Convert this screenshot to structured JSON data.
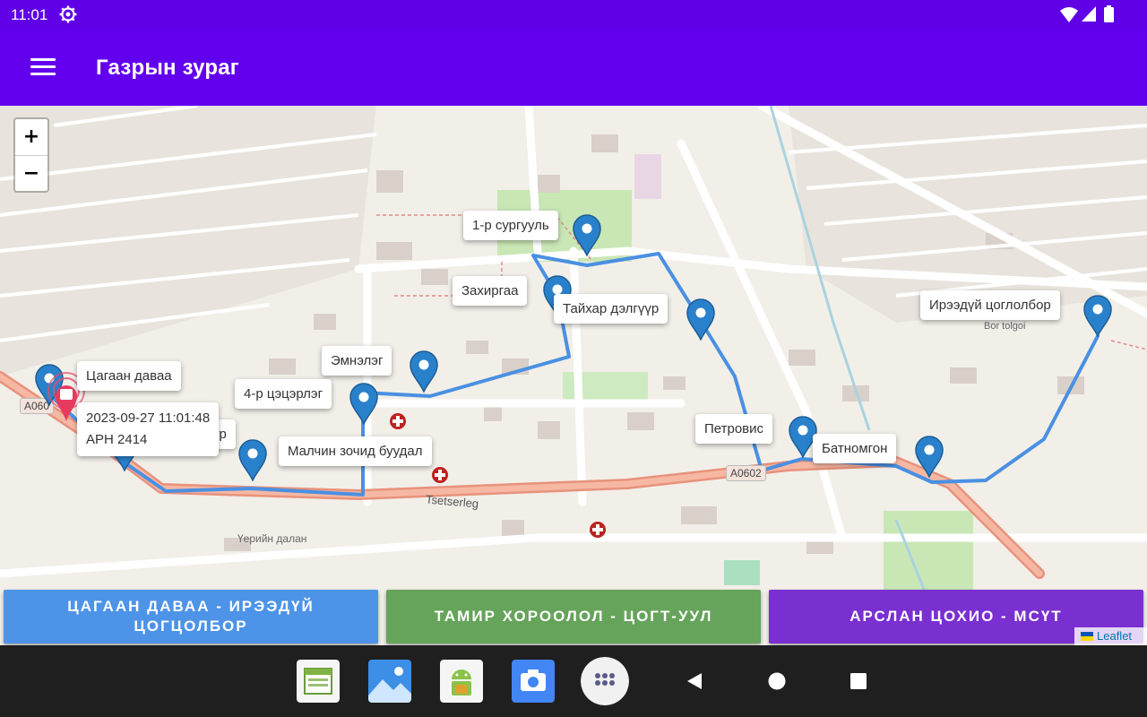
{
  "status_bar": {
    "time": "11:01"
  },
  "app_bar": {
    "title": "Газрын зураг"
  },
  "map": {
    "zoom_in": "+",
    "zoom_out": "−",
    "labels": {
      "school": "1-р сургууль",
      "zakhirgaa": "Захиргаа",
      "taikhar": "Тайхар дэлгүүр",
      "ireedui": "Ирээдүй цоглолбор",
      "emnelg": "Эмнэлэг",
      "ts4": "4-р цэцэрлэг",
      "tsagaan": "Цагаан даваа",
      "az": "Аз дэлгүүр",
      "malchin": "Малчин зочид буудал",
      "petrovis": "Петровис",
      "batnomgon": "Батномгон"
    },
    "vehicle": {
      "time": "2023-09-27 11:01:48",
      "plate": "АРН 2414"
    },
    "road_labels": {
      "tsetserleg": "Tsetserleg",
      "a0602": "A0602",
      "a060": "A060",
      "uerin": "Үерийн далан",
      "bor": "Bor tolgoi"
    },
    "attribution": "Leaflet"
  },
  "routes": [
    {
      "label": "ЦАГААН ДАВАА - ИРЭЭДҮЙ ЦОГЦОЛБОР",
      "color": "#4d94e8"
    },
    {
      "label": "ТАМИР ХОРООЛОЛ - ЦОГТ-УУЛ",
      "color": "#65a45a"
    },
    {
      "label": "АРСЛАН ЦОХИО - МСҮТ",
      "color": "#7a2fd0"
    }
  ],
  "colors": {
    "primary": "#6200ee",
    "route_line": "#4a90e2",
    "marker": "#2a81cb",
    "main_road": "#e8927c"
  },
  "dock_icons": [
    "calendar-app-icon",
    "gallery-app-icon",
    "android-app-icon",
    "camera-app-icon",
    "app-drawer-icon"
  ]
}
